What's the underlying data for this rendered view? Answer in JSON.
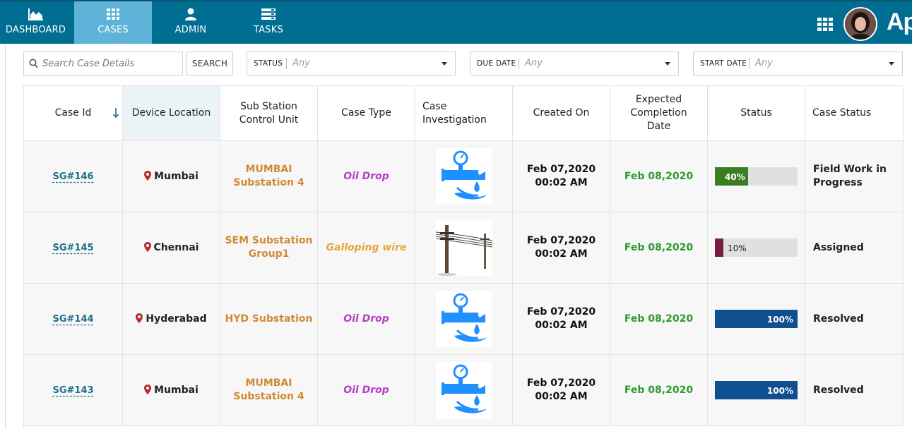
{
  "nav": {
    "items": [
      {
        "label": "DASHBOARD",
        "icon": "area-chart-icon"
      },
      {
        "label": "CASES",
        "icon": "grid-icon"
      },
      {
        "label": "ADMIN",
        "icon": "user-icon"
      },
      {
        "label": "TASKS",
        "icon": "server-icon"
      }
    ],
    "active": "CASES",
    "brand": "App"
  },
  "toolbar": {
    "search_placeholder": "Search Case Details",
    "search_button": "SEARCH",
    "filters": [
      {
        "label": "STATUS",
        "value": "Any"
      },
      {
        "label": "DUE DATE",
        "value": "Any"
      },
      {
        "label": "START DATE",
        "value": "Any"
      }
    ]
  },
  "table": {
    "columns": [
      "Case Id",
      "Device Location",
      "Sub Station Control Unit",
      "Case Type",
      "Case Investigation",
      "Created On",
      "Expected Completion Date",
      "Status",
      "Case Status"
    ],
    "header_lines": {
      "sub_station": [
        "Sub Station",
        "Control Unit"
      ],
      "case_investigation": [
        "Case",
        "Investigation"
      ],
      "expected": [
        "Expected",
        "Completion",
        "Date"
      ]
    },
    "rows": [
      {
        "id": "SG#146",
        "location": "Mumbai",
        "substation": [
          "MUMBAI",
          "Substation 4"
        ],
        "case_type": "Oil Drop",
        "type_color": "#b43fc4",
        "image": "oil-drop-icon",
        "created": [
          "Feb 07,2020",
          "00:02 AM"
        ],
        "expected": "Feb 08,2020",
        "progress": 40,
        "progress_label": "40%",
        "bar_color": "#3a7d23",
        "case_status": [
          "Field Work in",
          "Progress"
        ]
      },
      {
        "id": "SG#145",
        "location": "Chennai",
        "substation": [
          "SEM Substation",
          "Group1"
        ],
        "case_type": "Galloping wire",
        "type_color": "#e8a63a",
        "image": "power-pole-photo",
        "created": [
          "Feb 07,2020",
          "00:02 AM"
        ],
        "expected": "Feb 08,2020",
        "progress": 10,
        "progress_label": "10%",
        "bar_color": "#7a1d45",
        "case_status": [
          "Assigned"
        ]
      },
      {
        "id": "SG#144",
        "location": "Hyderabad",
        "substation": [
          "HYD Substation"
        ],
        "case_type": "Oil Drop",
        "type_color": "#b43fc4",
        "image": "oil-drop-icon",
        "created": [
          "Feb 07,2020",
          "00:02 AM"
        ],
        "expected": "Feb 08,2020",
        "progress": 100,
        "progress_label": "100%",
        "bar_color": "#0f4f8f",
        "case_status": [
          "Resolved"
        ]
      },
      {
        "id": "SG#143",
        "location": "Mumbai",
        "substation": [
          "MUMBAI",
          "Substation 4"
        ],
        "case_type": "Oil Drop",
        "type_color": "#b43fc4",
        "image": "oil-drop-icon",
        "created": [
          "Feb 07,2020",
          "00:02 AM"
        ],
        "expected": "Feb 08,2020",
        "progress": 100,
        "progress_label": "100%",
        "bar_color": "#0f4f8f",
        "case_status": [
          "Resolved"
        ]
      }
    ]
  },
  "colors": {
    "topbar": "#006d92",
    "active_tab": "#5fb2d8",
    "pin": "#b52a2a"
  }
}
